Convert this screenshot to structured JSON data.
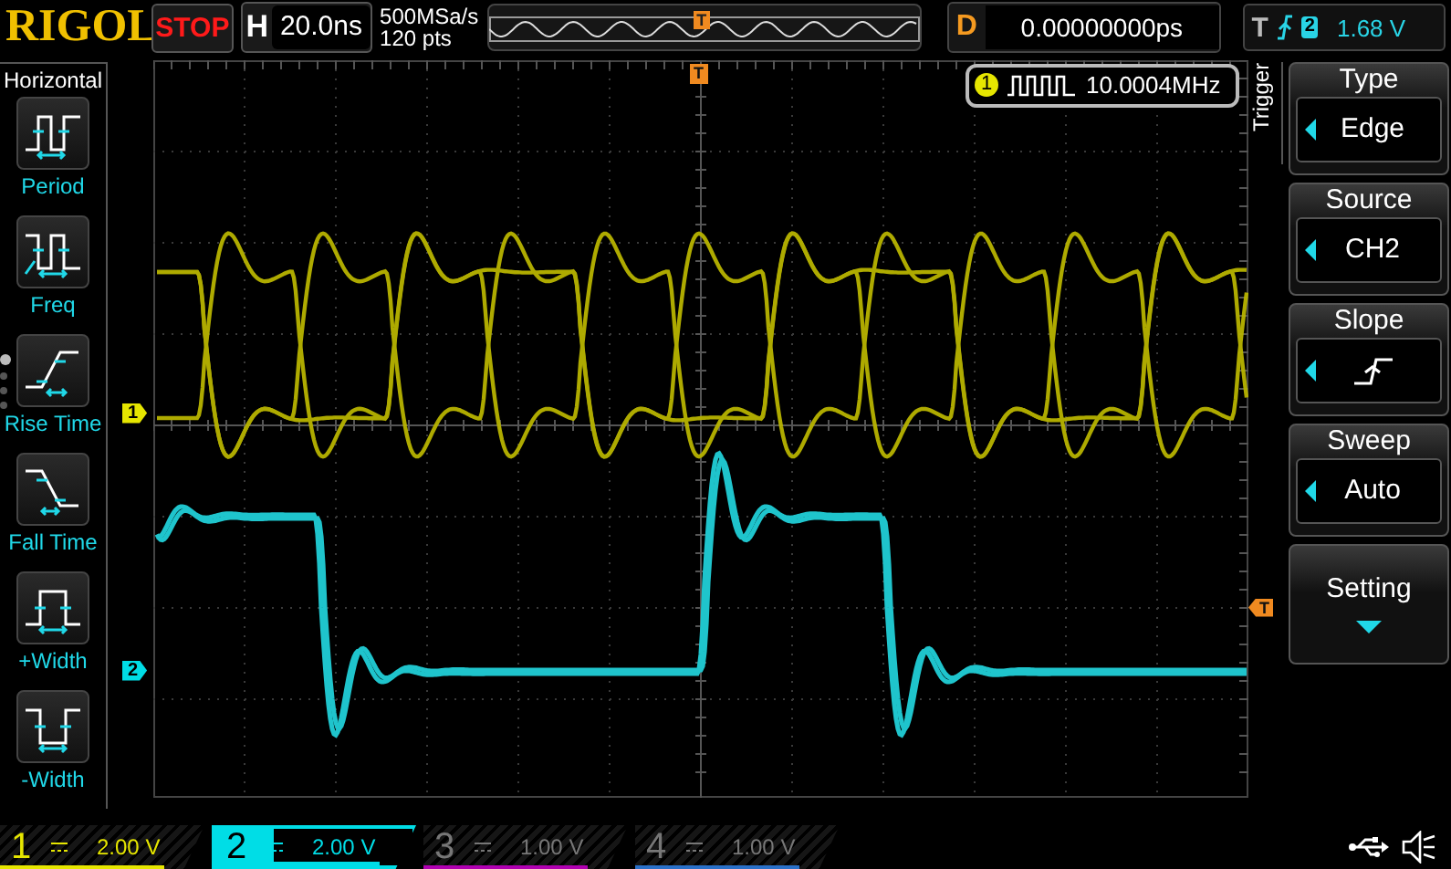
{
  "top_bar": {
    "brand": "RIGOL",
    "run_state": "STOP",
    "timebase": {
      "label": "H",
      "value": "20.0ns"
    },
    "sample_rate": "500MSa/s",
    "memory_depth": "120 pts",
    "overview_marker": "T",
    "delay": {
      "label": "D",
      "value": "0.00000000ps"
    },
    "trigger": {
      "label": "T",
      "source": "2",
      "level": "1.68 V"
    }
  },
  "left_menu": {
    "title": "Horizontal",
    "page_dots": [
      {
        "selected": true
      },
      {
        "selected": false
      },
      {
        "selected": false
      },
      {
        "selected": false
      }
    ],
    "items": [
      {
        "kind": "period",
        "label": "Period"
      },
      {
        "kind": "freq",
        "label": "Freq"
      },
      {
        "kind": "rise",
        "label": "Rise Time"
      },
      {
        "kind": "fall",
        "label": "Fall Time"
      },
      {
        "kind": "pwidth",
        "label": "+Width"
      },
      {
        "kind": "nwidth",
        "label": "-Width"
      }
    ]
  },
  "measurement": {
    "channel": "1",
    "value": "10.0004MHz"
  },
  "markers": {
    "trigger_position": "T",
    "trigger_level": "T",
    "channels": [
      {
        "label": "1",
        "color": "#e6e600"
      },
      {
        "label": "2",
        "color": "#00dde6"
      }
    ]
  },
  "right_menu": {
    "title": "Trigger",
    "items": [
      {
        "kind": "select",
        "title": "Type",
        "value": "Edge"
      },
      {
        "kind": "select",
        "title": "Source",
        "value": "CH2"
      },
      {
        "kind": "slope",
        "title": "Slope"
      },
      {
        "kind": "select",
        "title": "Sweep",
        "value": "Auto"
      },
      {
        "kind": "submenu",
        "title": "Setting"
      }
    ]
  },
  "channels": [
    {
      "number": "1",
      "scale": "2.00 V",
      "enabled": true,
      "selected": false,
      "color": "#e6e600"
    },
    {
      "number": "2",
      "scale": "2.00 V",
      "enabled": true,
      "selected": true,
      "color": "#00dde6"
    },
    {
      "number": "3",
      "scale": "1.00 V",
      "enabled": false,
      "selected": false,
      "color": "#b000b0"
    },
    {
      "number": "4",
      "scale": "1.00 V",
      "enabled": false,
      "selected": false,
      "color": "#2a70c8"
    }
  ]
}
